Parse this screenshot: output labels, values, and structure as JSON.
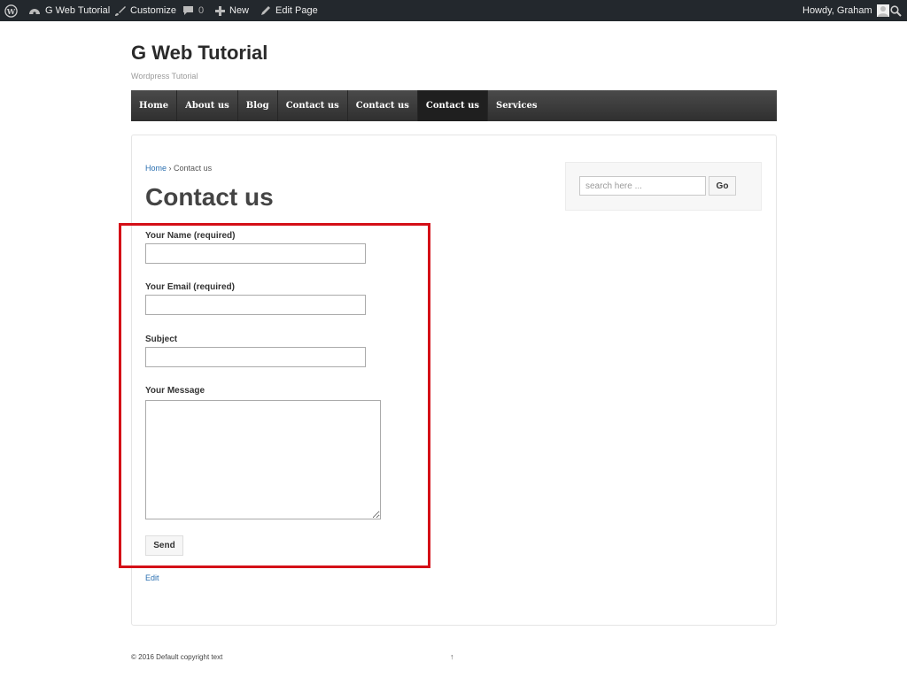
{
  "admin_bar": {
    "site_name": "G Web Tutorial",
    "customize": "Customize",
    "comments_count": "0",
    "new": "New",
    "edit_page": "Edit Page",
    "howdy": "Howdy, Graham"
  },
  "site": {
    "title": "G Web Tutorial",
    "description": "Wordpress Tutorial"
  },
  "nav": {
    "items": [
      "Home",
      "About us",
      "Blog",
      "Contact us",
      "Contact us",
      "Contact us",
      "Services"
    ],
    "active_index": 5
  },
  "breadcrumb": {
    "home": "Home",
    "separator": "›",
    "current": "Contact us"
  },
  "page": {
    "title": "Contact us",
    "edit_link": "Edit"
  },
  "form": {
    "name_label": "Your Name (required)",
    "email_label": "Your Email (required)",
    "subject_label": "Subject",
    "message_label": "Your Message",
    "send_label": "Send"
  },
  "sidebar": {
    "search_placeholder": "search here ...",
    "go_label": "Go"
  },
  "footer": {
    "copyright": "© 2016 Default copyright text",
    "top_arrow": "↑"
  },
  "colors": {
    "admin_bar": "#23282d",
    "nav": "#3a3a3a",
    "link": "#2a6fb0",
    "highlight": "#d40f17"
  }
}
